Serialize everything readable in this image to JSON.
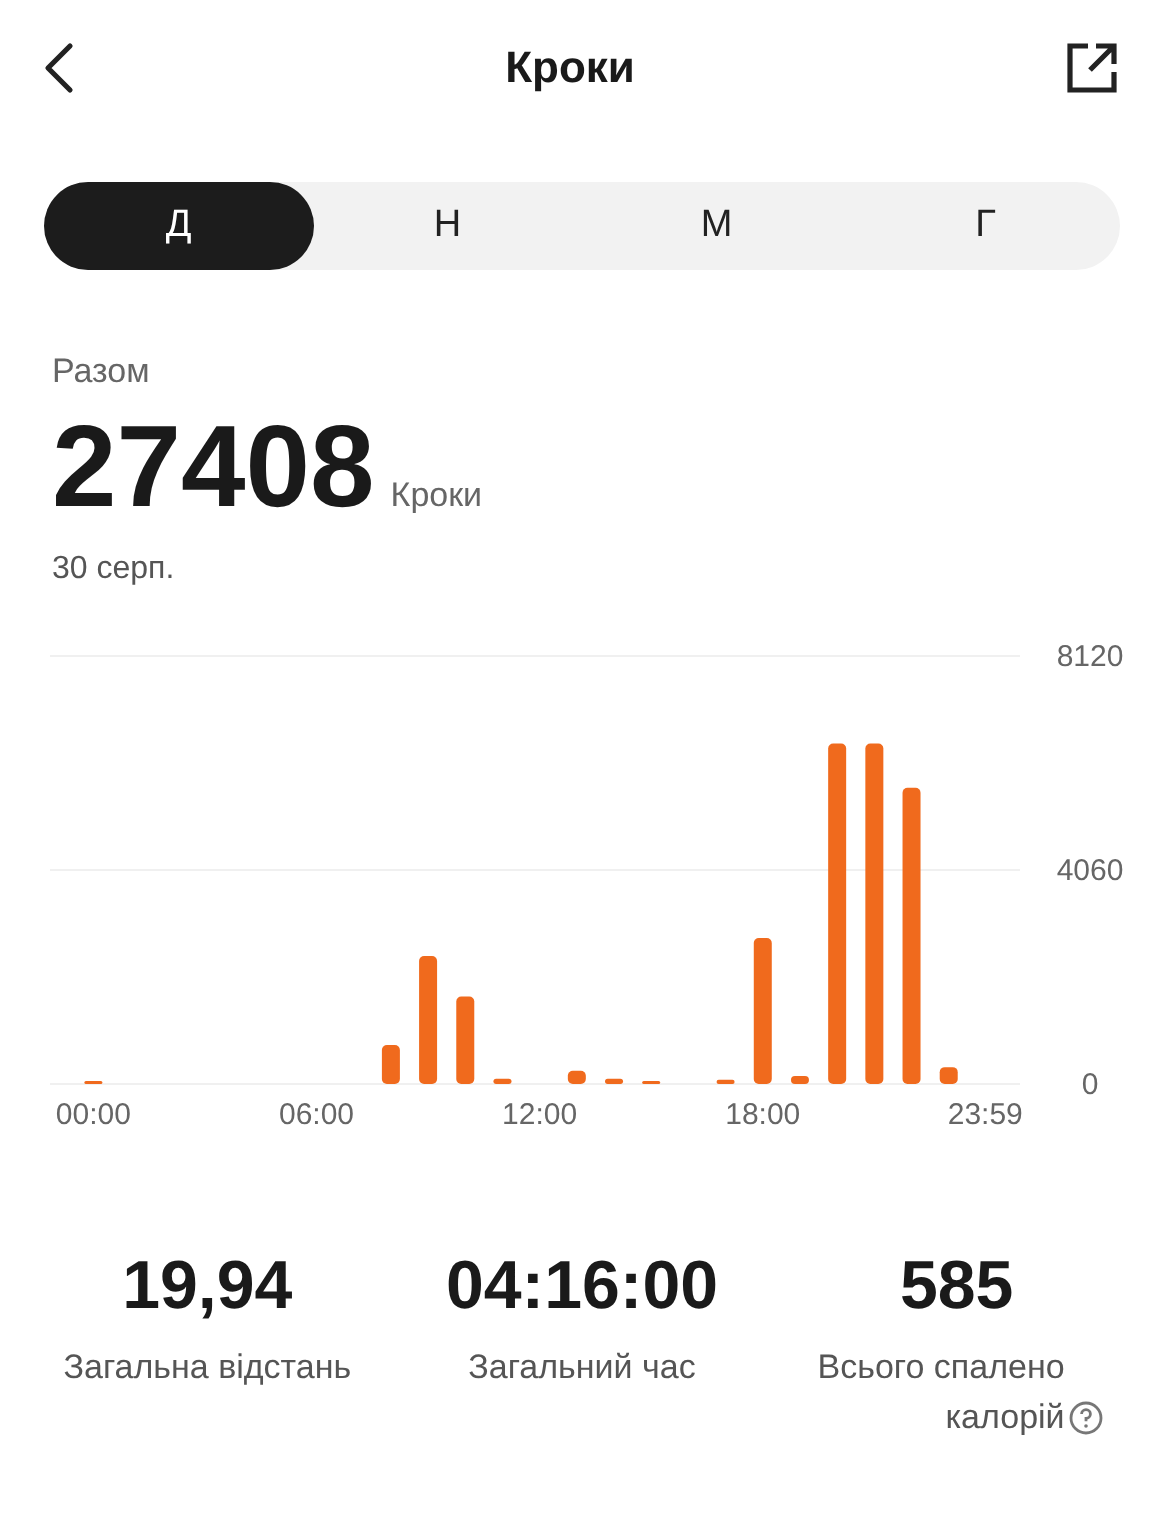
{
  "header": {
    "title": "Кроки"
  },
  "tabs": [
    {
      "label": "Д",
      "selected": true
    },
    {
      "label": "Н",
      "selected": false
    },
    {
      "label": "М",
      "selected": false
    },
    {
      "label": "Г",
      "selected": false
    }
  ],
  "summary": {
    "label": "Разом",
    "value": "27408",
    "unit": "Кроки",
    "date": "30 серп."
  },
  "chart": {
    "chart_data": {
      "type": "bar",
      "x": [
        0,
        480,
        540,
        600,
        660,
        780,
        840,
        900,
        1020,
        1080,
        1140,
        1200,
        1260,
        1320,
        1380
      ],
      "xlim": [
        -70,
        1495
      ],
      "series": [
        {
          "color": "#f06a1d",
          "values": [
            30,
            740,
            2430,
            1660,
            100,
            250,
            100,
            30,
            80,
            2770,
            150,
            6460,
            6460,
            5620,
            320
          ]
        }
      ],
      "ylim": [
        0,
        8120
      ],
      "yticks": [
        0,
        4060,
        8120
      ],
      "xticks": [
        {
          "value": 0,
          "label": "00:00"
        },
        {
          "value": 360,
          "label": "06:00"
        },
        {
          "value": 720,
          "label": "12:00"
        },
        {
          "value": 1080,
          "label": "18:00"
        },
        {
          "value": 1439,
          "label": "23:59"
        }
      ]
    }
  },
  "stats": [
    {
      "value": "19,94",
      "label": "Загальна відстань",
      "kind": "plain"
    },
    {
      "value": "04:16:00",
      "label": "Загальний час",
      "kind": "plain"
    },
    {
      "value": "585",
      "label": "Всього спалено калорій",
      "kind": "help"
    }
  ]
}
